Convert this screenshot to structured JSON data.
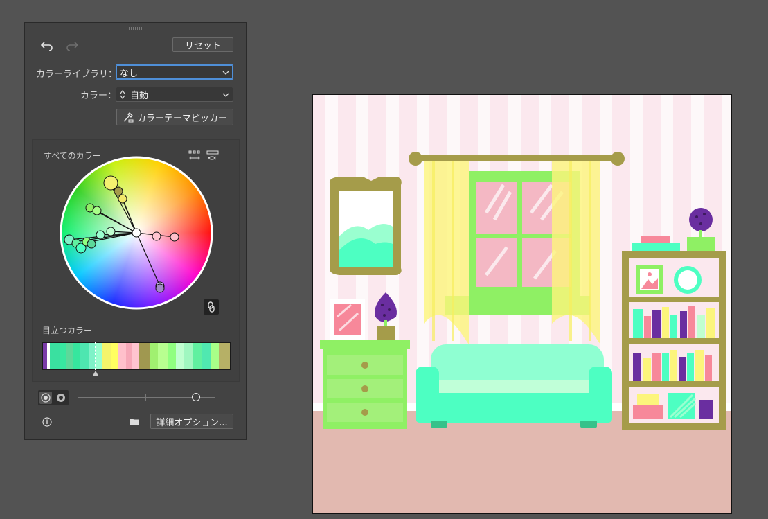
{
  "panel": {
    "reset_label": "リセット",
    "library_label": "カラーライブラリ：",
    "library_value": "なし",
    "color_label": "カラー：",
    "color_value": "自動",
    "picker_label": "カラーテーマピッカー",
    "all_colors_label": "すべてのカラー",
    "prominent_label": "目立つカラー",
    "options_label": "詳細オプション...",
    "prominent_colors": [
      "#7a3aa8",
      "#ffffff",
      "#3ae0a0",
      "#38e8a0",
      "#5cd99a",
      "#36e69e",
      "#4ee6b0",
      "#7ff2c8",
      "#9affd0",
      "#f4f46a",
      "#ffff60",
      "#ffc0cb",
      "#f7a8b8",
      "#ffc4d0",
      "#a09850",
      "#a0f070",
      "#b8ff90",
      "#90ff80",
      "#c0ffd0",
      "#a0f7c0",
      "#60f0a0",
      "#50e8b0",
      "#a8ff88",
      "#b6b066"
    ]
  },
  "colors": {
    "accent": "#4f8fd8",
    "wall": "#fbe8ee",
    "floor": "#e2b9b0",
    "mint": "#4dffc2",
    "lime": "#8ff064",
    "olive": "#a59c4a",
    "purple": "#6a2ea0",
    "pink": "#f7889a",
    "yellow": "#fcf57c"
  }
}
